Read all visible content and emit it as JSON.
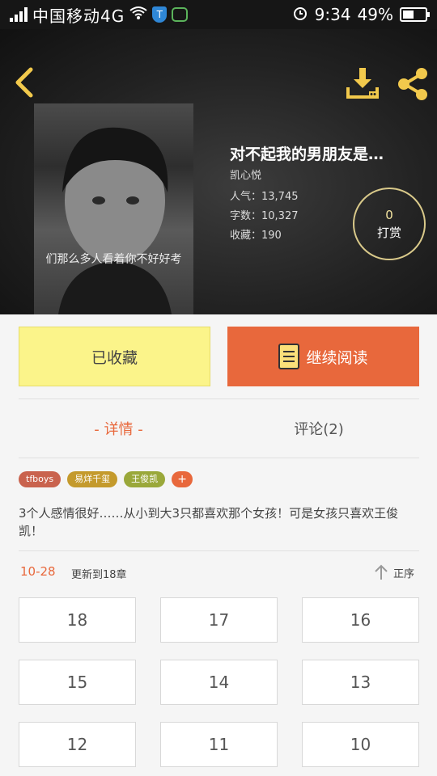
{
  "status_bar": {
    "carrier": "中国移动4G",
    "time": "9:34",
    "battery": "49%"
  },
  "book": {
    "title": "对不起我的男朋友是…",
    "author": "凯心悦",
    "popularity": "人气：13,745",
    "word_count": "字数：10,327",
    "favorites": "收藏：190",
    "cover_caption": "们那么多人看着你不好好考"
  },
  "tip": {
    "count": "0",
    "label": "打赏"
  },
  "actions": {
    "favorited_label": "已收藏",
    "continue_label": "继续阅读"
  },
  "tabs": {
    "details": "- 详情 -",
    "comments": "评论(2)"
  },
  "tags": [
    {
      "label": "tfboys",
      "color": "#c9634e"
    },
    {
      "label": "易烊千玺",
      "color": "#c49a2c"
    },
    {
      "label": "王俊凯",
      "color": "#9aa83a"
    },
    {
      "label": "+",
      "color": "#e8683c"
    }
  ],
  "description": "3个人感情很好……从小到大3只都喜欢那个女孩！可是女孩只喜欢王俊凯！",
  "update": {
    "date": "10-28",
    "text": "更新到18章",
    "sort_label": "正序"
  },
  "chapters": [
    "18",
    "17",
    "16",
    "15",
    "14",
    "13",
    "12",
    "11",
    "10"
  ],
  "icons": {
    "back": "chevron-left-icon",
    "download": "download-icon",
    "share": "share-icon",
    "sort": "arrow-up-icon"
  },
  "colors": {
    "accent": "#e8683c",
    "favorite_button": "#fbf48a",
    "header_icon": "#f2c94c"
  }
}
